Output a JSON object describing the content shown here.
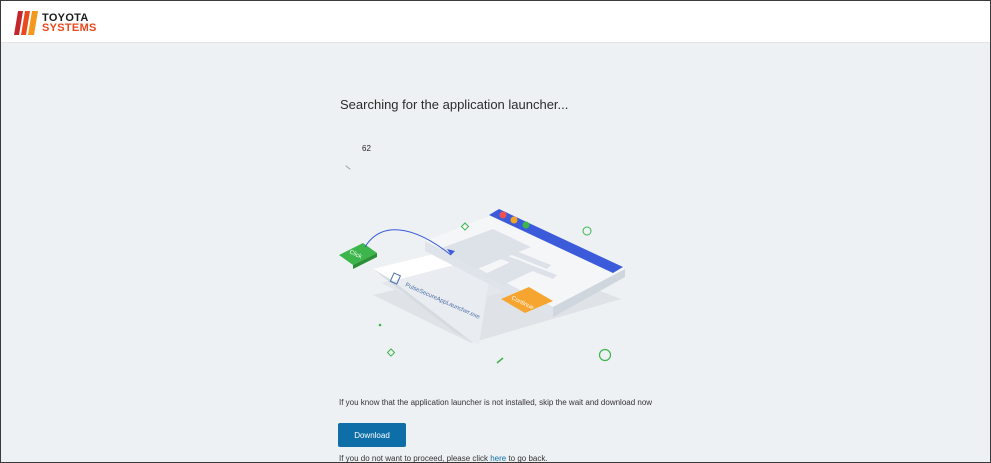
{
  "header": {
    "logo_line1": "TOYOTA",
    "logo_line2": "SYSTEMS"
  },
  "main": {
    "title": "Searching for the application launcher...",
    "countdown": "62",
    "illustration": {
      "click_label": "Click",
      "file_label": "PulseSecureAppLauncher.exe",
      "continue_label": "Continue"
    },
    "message": "If you know that the application launcher is not installed, skip the wait and download now",
    "download_label": "Download",
    "footer_prefix": "If you do not want to proceed, please click ",
    "footer_link": "here",
    "footer_suffix": " to go back."
  },
  "colors": {
    "accent": "#0d6ea8",
    "brand_orange": "#e8491d",
    "background": "#eef1f4"
  }
}
